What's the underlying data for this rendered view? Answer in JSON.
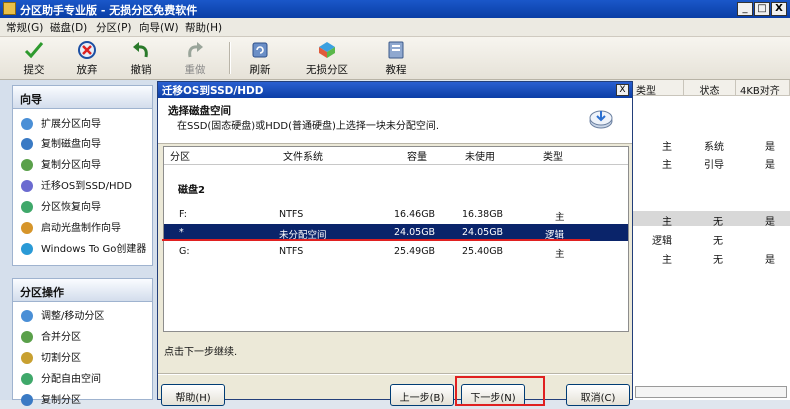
{
  "window": {
    "title": "分区助手专业版 - 无损分区免费软件",
    "minimize": "_",
    "restore": "□",
    "close": "X"
  },
  "menu": [
    "常规(G)",
    "磁盘(D)",
    "分区(P)",
    "向导(W)",
    "帮助(H)"
  ],
  "toolbar": [
    {
      "label": "提交",
      "icon": "commit-icon"
    },
    {
      "label": "放弃",
      "icon": "discard-icon"
    },
    {
      "label": "撤销",
      "icon": "undo-icon"
    },
    {
      "label": "重做",
      "icon": "redo-icon"
    },
    {
      "label": "刷新",
      "icon": "refresh-icon"
    },
    {
      "label": "无损分区",
      "icon": "lossless-partition-icon"
    },
    {
      "label": "教程",
      "icon": "tutorial-icon"
    }
  ],
  "sidebar": {
    "wizard_title": "向导",
    "wizard_items": [
      "扩展分区向导",
      "复制磁盘向导",
      "复制分区向导",
      "迁移OS到SSD/HDD",
      "分区恢复向导",
      "启动光盘制作向导",
      "Windows To Go创建器"
    ],
    "ops_title": "分区操作",
    "ops_items": [
      "调整/移动分区",
      "合并分区",
      "切割分区",
      "分配自由空间",
      "复制分区"
    ]
  },
  "right_grid": {
    "headers": [
      "类型",
      "状态",
      "4KB对齐"
    ],
    "rows": [
      {
        "type": "主",
        "status": "系统",
        "align": "是"
      },
      {
        "type": "主",
        "status": "引导",
        "align": "是"
      },
      {
        "type": "主",
        "status": "无",
        "align": "是"
      },
      {
        "type": "逻辑",
        "status": "无",
        "align": ""
      },
      {
        "type": "主",
        "status": "无",
        "align": "是"
      }
    ]
  },
  "dialog": {
    "title": "迁移OS到SSD/HDD",
    "close": "X",
    "heading": "选择磁盘空间",
    "description": "在SSD(固态硬盘)或HDD(普通硬盘)上选择一块未分配空间.",
    "columns": [
      "分区",
      "文件系统",
      "容量",
      "未使用",
      "类型"
    ],
    "disk_label": "磁盘2",
    "rows": [
      {
        "partition": "F:",
        "fs": "NTFS",
        "capacity": "16.46GB",
        "unused": "16.38GB",
        "type": "主"
      },
      {
        "partition": "*",
        "fs": "未分配空间",
        "capacity": "24.05GB",
        "unused": "24.05GB",
        "type": "逻辑"
      },
      {
        "partition": "G:",
        "fs": "NTFS",
        "capacity": "25.49GB",
        "unused": "25.40GB",
        "type": "主"
      }
    ],
    "hint": "点击下一步继续.",
    "buttons": {
      "help": "帮助(H)",
      "back": "上一步(B)",
      "next": "下一步(N)",
      "cancel": "取消(C)"
    }
  }
}
